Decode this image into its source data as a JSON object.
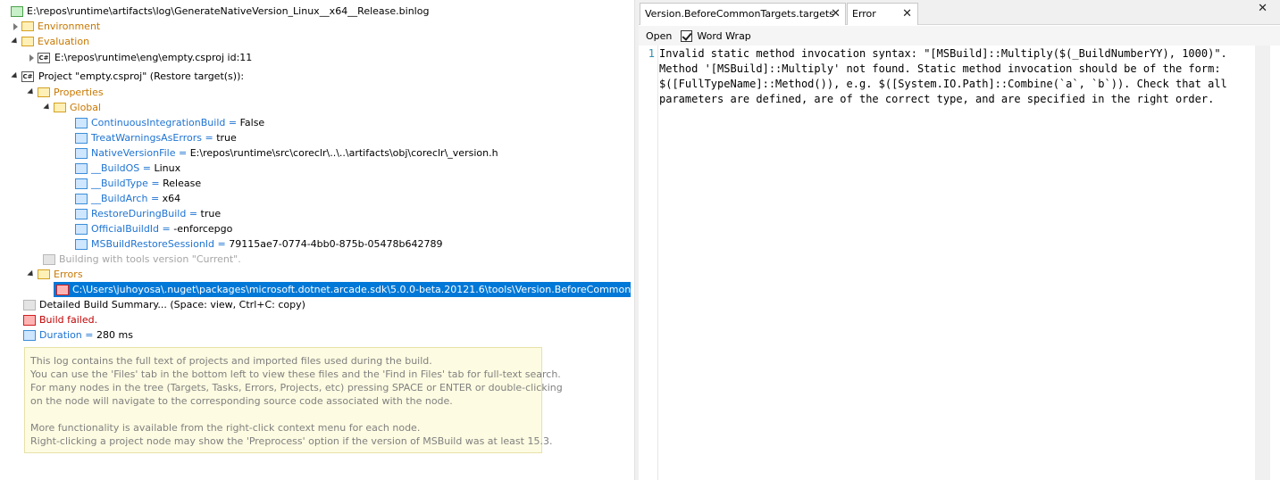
{
  "tree": {
    "root": "E:\\repos\\runtime\\artifacts\\log\\GenerateNativeVersion_Linux__x64__Release.binlog",
    "environment": "Environment",
    "evaluation": "Evaluation",
    "eval_project": "E:\\repos\\runtime\\eng\\empty.csproj id:11",
    "project": "Project \"empty.csproj\" (Restore target(s)):",
    "properties": "Properties",
    "global": "Global",
    "props": [
      {
        "name": "ContinuousIntegrationBuild",
        "value": "False"
      },
      {
        "name": "TreatWarningsAsErrors",
        "value": "true"
      },
      {
        "name": "NativeVersionFile",
        "value": "E:\\repos\\runtime\\src\\coreclr\\..\\..\\artifacts\\obj\\coreclr\\_version.h"
      },
      {
        "name": "__BuildOS",
        "value": "Linux"
      },
      {
        "name": "__BuildType",
        "value": "Release"
      },
      {
        "name": "__BuildArch",
        "value": "x64"
      },
      {
        "name": "RestoreDuringBuild",
        "value": "true"
      },
      {
        "name": "OfficialBuildId",
        "value": "-enforcepgo"
      },
      {
        "name": "MSBuildRestoreSessionId",
        "value": "79115ae7-0774-4bb0-875b-05478b642789"
      }
    ],
    "equals": " = ",
    "tools_version": "Building with tools version \"Current\".",
    "errors": "Errors",
    "error_item": "C:\\Users\\juhoyosa\\.nuget\\packages\\microsoft.dotnet.arcade.sdk\\5.0.0-beta.20121.6\\tools\\Version.BeforeCommonTargets.targets",
    "summary": "Detailed Build Summary... (Space: view, Ctrl+C: copy)",
    "build_failed": "Build failed.",
    "duration_label": "Duration",
    "duration_value": "280 ms"
  },
  "info": {
    "lines": [
      "This log contains the full text of projects and imported files used during the build.",
      "You can use the 'Files' tab in the bottom left to view these files and the 'Find in Files' tab for full-text search.",
      "For many nodes in the tree (Targets, Tasks, Errors, Projects, etc) pressing SPACE or ENTER or double-clicking",
      "on the node will navigate to the corresponding source code associated with the node.",
      "",
      "More functionality is available from the right-click context menu for each node.",
      "Right-clicking a project node may show the 'Preprocess' option if the version of MSBuild was at least 15.3."
    ]
  },
  "tabs": {
    "tab1": "Version.BeforeCommonTargets.targets",
    "tab2": "Error",
    "close_glyph": "✕"
  },
  "toolbar": {
    "open": "Open",
    "word_wrap": "Word Wrap"
  },
  "editor": {
    "line_number": "1",
    "text": "Invalid static method invocation syntax: \"[MSBuild]::Multiply($(_BuildNumberYY), 1000)\". Method '[MSBuild]::Multiply' not found. Static method invocation should be of the form: $([FullTypeName]::Method()), e.g. $([System.IO.Path]::Combine(`a`, `b`)). Check that all parameters are defined, are of the correct type, and are specified in the right order."
  }
}
